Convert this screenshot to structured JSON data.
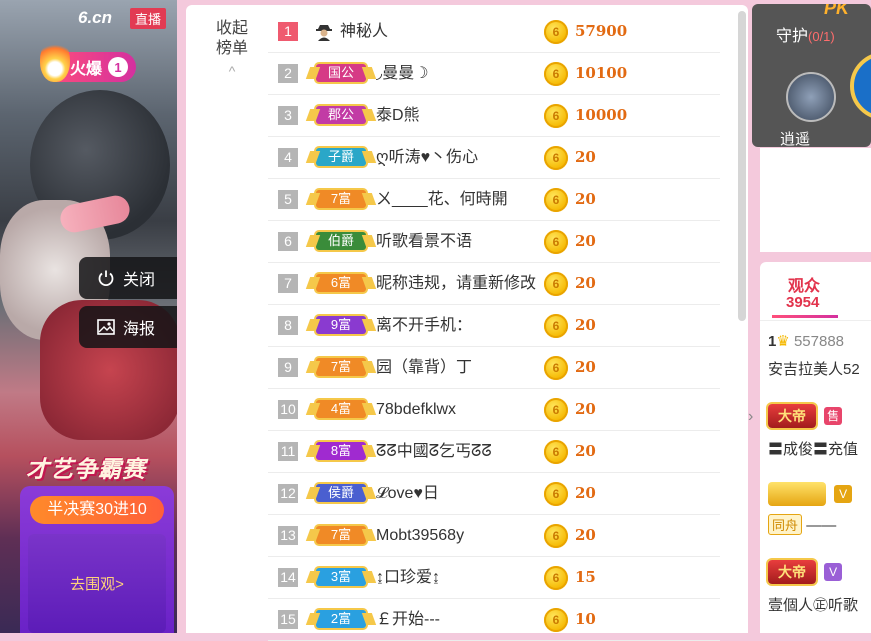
{
  "stream": {
    "site_logo": "6.cn",
    "live_tag": "直播",
    "hot_label": "火爆",
    "hot_count": "1",
    "close_label": "关闭",
    "poster_label": "海报",
    "promo_title": "才艺争霸赛",
    "promo_subtitle": "半决赛30进10",
    "promo_button": "去围观>"
  },
  "rank_panel": {
    "collapse_label": "收起榜单",
    "rows": [
      {
        "rank": "1",
        "badge": "",
        "name": "神秘人",
        "score": "57900"
      },
      {
        "rank": "2",
        "badge": "国公",
        "name": "◞曼曼☽",
        "score": "10100"
      },
      {
        "rank": "3",
        "badge": "郡公",
        "name": "泰D熊",
        "score": "10000"
      },
      {
        "rank": "4",
        "badge": "子爵",
        "name": "ღ听涛♥丶伤心",
        "score": "20"
      },
      {
        "rank": "5",
        "badge": "7富",
        "name": "ㄨ____花、何時開",
        "score": "20"
      },
      {
        "rank": "6",
        "badge": "伯爵",
        "name": "听歌看景不语",
        "score": "20"
      },
      {
        "rank": "7",
        "badge": "6富",
        "name": "昵称违规，请重新修改",
        "score": "20"
      },
      {
        "rank": "8",
        "badge": "9富",
        "name": "离不开手机：",
        "score": "20"
      },
      {
        "rank": "9",
        "badge": "7富",
        "name": "园（靠背）丁",
        "score": "20"
      },
      {
        "rank": "10",
        "badge": "4富",
        "name": "78bdefklwx",
        "score": "20"
      },
      {
        "rank": "11",
        "badge": "8富",
        "name": "ᘔᘔ中國ᘔ乞丐ᘔᘔ",
        "score": "20"
      },
      {
        "rank": "12",
        "badge": "侯爵",
        "name": "𝓛ove♥日",
        "score": "20"
      },
      {
        "rank": "13",
        "badge": "7富",
        "name": "Mobt39568y",
        "score": "20"
      },
      {
        "rank": "14",
        "badge": "3富",
        "name": "↨口珍爱↨",
        "score": "15"
      },
      {
        "rank": "15",
        "badge": "2富",
        "name": "￡开始---",
        "score": "10"
      }
    ]
  },
  "guard_panel": {
    "pk_label": "PK",
    "label": "守护",
    "count": "(0/1)",
    "guard_name": "逍遥"
  },
  "audience_panel": {
    "title": "观众",
    "count": "3954",
    "items": [
      {
        "line1": "557888",
        "line2": "安吉拉美人52"
      },
      {
        "badge": "大帝",
        "tag": "售",
        "line2": "〓成俊〓充值"
      },
      {
        "badge": "V",
        "tag": "同舟",
        "line2": "——"
      },
      {
        "badge": "大帝",
        "tag": "V",
        "line2": "壹個人㊣听歌"
      }
    ]
  },
  "colors": {
    "accent": "#e2334c",
    "score": "#e26a12",
    "page_bg": "#f4c9dc"
  }
}
